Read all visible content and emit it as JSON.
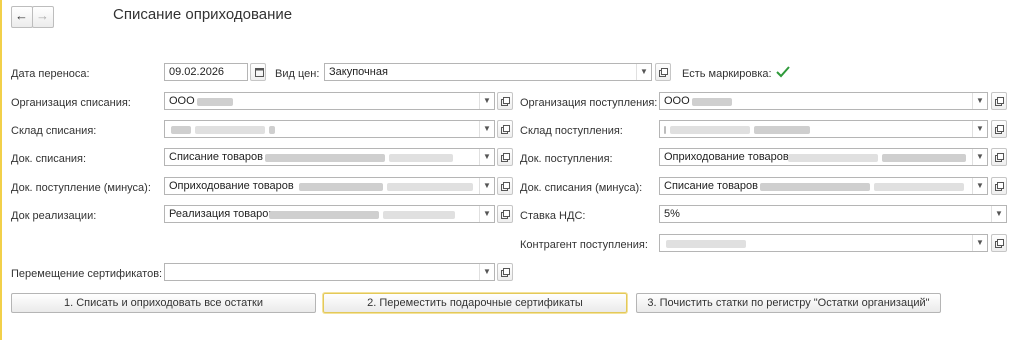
{
  "window": {
    "title": "Списание оприходование"
  },
  "nav": {
    "back_glyph": "←",
    "forward_glyph": "→"
  },
  "form": {
    "date": {
      "label": "Дата переноса:",
      "value": "09.02.2026"
    },
    "price_type": {
      "label": "Вид цен:",
      "value": "Закупочная"
    },
    "marking": {
      "label": "Есть маркировка:",
      "checked": true
    },
    "org_write_off": {
      "label": "Организация списания:",
      "value": "ООО"
    },
    "org_receipt": {
      "label": "Организация поступления:",
      "value": "ООО"
    },
    "wh_write_off": {
      "label": "Склад списания:",
      "value": ""
    },
    "wh_receipt": {
      "label": "Склад поступления:",
      "value": ""
    },
    "doc_write_off": {
      "label": "Док. списания:",
      "value": "Списание товаров"
    },
    "doc_receipt": {
      "label": "Док. поступления:",
      "value": "Оприходование товаров"
    },
    "doc_receipt_minus": {
      "label": "Док. поступление (минуса):",
      "value": "Оприходование товаров"
    },
    "doc_write_off_minus": {
      "label": "Док. списания (минуса):",
      "value": "Списание товаров"
    },
    "doc_sale": {
      "label": "Док реализации:",
      "value": "Реализация товаров"
    },
    "vat_rate": {
      "label": "Ставка НДС:",
      "value": "5%"
    },
    "counterparty": {
      "label": "Контрагент поступления:",
      "value": ""
    },
    "cert_move": {
      "label": "Перемещение сертификатов:",
      "value": ""
    }
  },
  "buttons": {
    "btn1": "1. Списать и оприходовать все остатки",
    "btn2": "2. Переместить подарочные сертификаты",
    "btn3": "3. Почистить статки по регистру \"Остатки организаций\""
  },
  "icons": {
    "dropdown": "triangle-down-icon",
    "open": "open-form-icon",
    "calendar": "calendar-icon",
    "checkbox": "checkmark-icon"
  },
  "colors": {
    "accent_yellow": "#f2d04a",
    "check_green": "#2e9a3a"
  }
}
